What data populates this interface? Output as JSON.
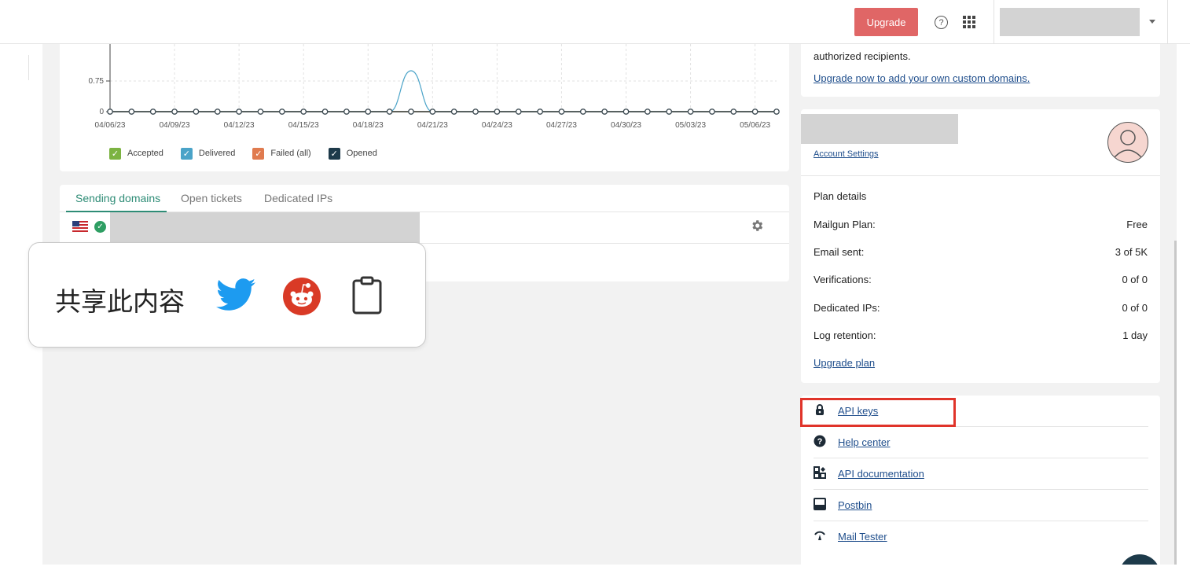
{
  "header": {
    "upgrade_label": "Upgrade",
    "help_icon_glyph": "?"
  },
  "chart_data": {
    "type": "line",
    "x": [
      "04/06/23",
      "04/07/23",
      "04/08/23",
      "04/09/23",
      "04/10/23",
      "04/11/23",
      "04/12/23",
      "04/13/23",
      "04/14/23",
      "04/15/23",
      "04/16/23",
      "04/17/23",
      "04/18/23",
      "04/19/23",
      "04/20/23",
      "04/21/23",
      "04/22/23",
      "04/23/23",
      "04/24/23",
      "04/25/23",
      "04/26/23",
      "04/27/23",
      "04/28/23",
      "04/29/23",
      "04/30/23",
      "05/01/23",
      "05/02/23",
      "05/03/23",
      "05/04/23",
      "05/05/23",
      "05/06/23",
      "05/07/23"
    ],
    "tick_labels": [
      "04/06/23",
      "04/09/23",
      "04/12/23",
      "04/15/23",
      "04/18/23",
      "04/21/23",
      "04/24/23",
      "04/27/23",
      "04/30/23",
      "05/03/23",
      "05/06/23"
    ],
    "y_tick_labels": [
      "0.75",
      "0"
    ],
    "series": [
      {
        "name": "Accepted",
        "color": "#7cb342",
        "values": [
          0,
          0,
          0,
          0,
          0,
          0,
          0,
          0,
          0,
          0,
          0,
          0,
          0,
          0,
          0,
          0,
          0,
          0,
          0,
          0,
          0,
          0,
          0,
          0,
          0,
          0,
          0,
          0,
          0,
          0,
          0,
          0
        ]
      },
      {
        "name": "Delivered",
        "color": "#4aa3c8",
        "values": [
          0,
          0,
          0,
          0,
          0,
          0,
          0,
          0,
          0,
          0,
          0,
          0,
          0,
          0,
          1,
          0,
          0,
          0,
          0,
          0,
          0,
          0,
          0,
          0,
          0,
          0,
          0,
          0,
          0,
          0,
          0,
          0
        ]
      },
      {
        "name": "Failed (all)",
        "color": "#e07b4f",
        "values": [
          0,
          0,
          0,
          0,
          0,
          0,
          0,
          0,
          0,
          0,
          0,
          0,
          0,
          0,
          0,
          0,
          0,
          0,
          0,
          0,
          0,
          0,
          0,
          0,
          0,
          0,
          0,
          0,
          0,
          0,
          0,
          0
        ]
      },
      {
        "name": "Opened",
        "color": "#1d3a4a",
        "values": [
          0,
          0,
          0,
          0,
          0,
          0,
          0,
          0,
          0,
          0,
          0,
          0,
          0,
          0,
          0,
          0,
          0,
          0,
          0,
          0,
          0,
          0,
          0,
          0,
          0,
          0,
          0,
          0,
          0,
          0,
          0,
          0
        ]
      }
    ],
    "ylim": [
      0,
      1
    ]
  },
  "legend": [
    {
      "label": "Accepted",
      "color": "#7cb342"
    },
    {
      "label": "Delivered",
      "color": "#4aa3c8"
    },
    {
      "label": "Failed (all)",
      "color": "#e07b4f"
    },
    {
      "label": "Opened",
      "color": "#1d3a4a"
    }
  ],
  "domains": {
    "tabs": [
      "Sending domains",
      "Open tickets",
      "Dedicated IPs"
    ],
    "active_tab": "Sending domains"
  },
  "share": {
    "label": "共享此内容",
    "icons": [
      "twitter-icon",
      "reddit-icon",
      "clipboard-icon"
    ]
  },
  "sandbox_card": {
    "text": "authorized recipients.",
    "link": "Upgrade now to add your own custom domains."
  },
  "account": {
    "settings_link": "Account Settings"
  },
  "plan": {
    "title": "Plan details",
    "rows": [
      {
        "label": "Mailgun Plan:",
        "value": "Free"
      },
      {
        "label": "Email sent:",
        "value": "3 of 5K"
      },
      {
        "label": "Verifications:",
        "value": "0 of 0"
      },
      {
        "label": "Dedicated IPs:",
        "value": "0 of 0"
      },
      {
        "label": "Log retention:",
        "value": "1 day"
      }
    ],
    "upgrade_link": "Upgrade plan"
  },
  "links": [
    {
      "label": "API keys",
      "icon": "lock-icon"
    },
    {
      "label": "Help center",
      "icon": "question-icon"
    },
    {
      "label": "API documentation",
      "icon": "widgets-icon"
    },
    {
      "label": "Postbin",
      "icon": "inbox-icon"
    },
    {
      "label": "Mail Tester",
      "icon": "mail-tester-icon"
    }
  ]
}
